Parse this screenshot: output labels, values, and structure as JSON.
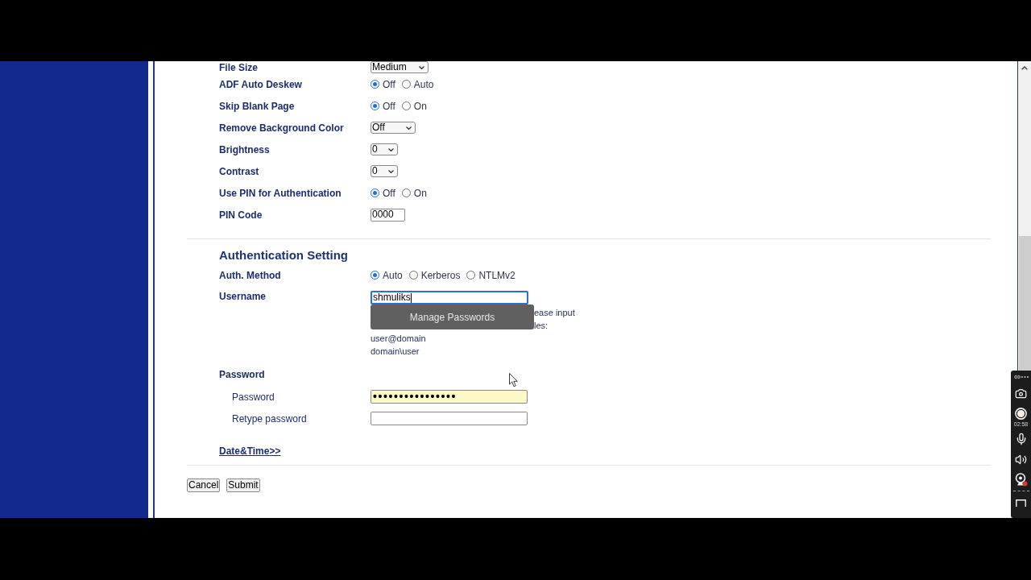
{
  "settings": [
    {
      "kind": "select",
      "label": "File Size",
      "value": "Medium"
    },
    {
      "kind": "radio",
      "label": "ADF Auto Deskew",
      "options": [
        {
          "label": "Off",
          "selected": true
        },
        {
          "label": "Auto",
          "selected": false
        }
      ]
    },
    {
      "kind": "radio",
      "label": "Skip Blank Page",
      "options": [
        {
          "label": "Off",
          "selected": true
        },
        {
          "label": "On",
          "selected": false
        }
      ]
    },
    {
      "kind": "select",
      "label": "Remove Background Color",
      "value": "Off"
    },
    {
      "kind": "select",
      "label": "Brightness",
      "value": "0"
    },
    {
      "kind": "select",
      "label": "Contrast",
      "value": "0"
    },
    {
      "kind": "radio",
      "label": "Use PIN for Authentication",
      "options": [
        {
          "label": "Off",
          "selected": true
        },
        {
          "label": "On",
          "selected": false
        }
      ]
    },
    {
      "kind": "text",
      "label": "PIN Code",
      "value": "0000"
    }
  ],
  "authentication": {
    "title": "Authentication Setting",
    "method": {
      "label": "Auth. Method",
      "options": [
        {
          "label": "Auto",
          "selected": true
        },
        {
          "label": "Kerberos",
          "selected": false
        },
        {
          "label": "NTLMv2",
          "selected": false
        }
      ]
    },
    "username": {
      "label": "Username",
      "value": "shmuliks",
      "focused": true
    },
    "autofill_menu": {
      "item": "Manage Passwords"
    },
    "hint": [
      "ease input",
      "les:"
    ],
    "examples": [
      "user@domain",
      "domain\\user"
    ]
  },
  "password": {
    "title": "Password",
    "fields": [
      {
        "label": "Password",
        "value": "••••••••••••••••",
        "autofilled": true
      },
      {
        "label": "Retype password",
        "autofilled": false
      }
    ]
  },
  "date_time_link": "Date&Time>>",
  "buttons": [
    "Cancel",
    "Submit"
  ],
  "recorder": {
    "timer": "02:58"
  }
}
